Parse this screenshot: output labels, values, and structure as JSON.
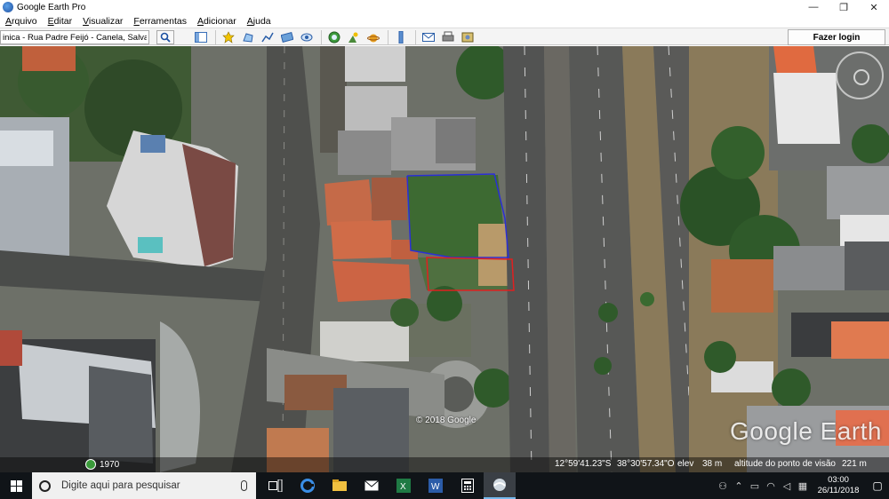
{
  "window": {
    "title": "Google Earth Pro",
    "minimize": "—",
    "maximize": "❐",
    "close": "✕"
  },
  "menu": [
    "Arquivo",
    "Editar",
    "Visualizar",
    "Ferramentas",
    "Adicionar",
    "Ajuda"
  ],
  "toolbar": {
    "search_value": "inica - Rua Padre Feijó - Canela, Salvador - BA",
    "login_label": "Fazer login"
  },
  "map": {
    "copyright": "© 2018 Google",
    "logo": "Google Earth",
    "imagery_year": "1970",
    "latitude": "12°59'41.23\"S",
    "longitude": "38°30'57.34\"O",
    "elev_label": "elev",
    "elevation": "38 m",
    "eye_label": "altitude do ponto de visão",
    "eye_altitude": "221 m",
    "polygon_colors": {
      "blue": "#2b2fd6",
      "red": "#e02020"
    }
  },
  "taskbar": {
    "search_placeholder": "Digite aqui para pesquisar",
    "time": "03:00",
    "date": "26/11/2018"
  }
}
